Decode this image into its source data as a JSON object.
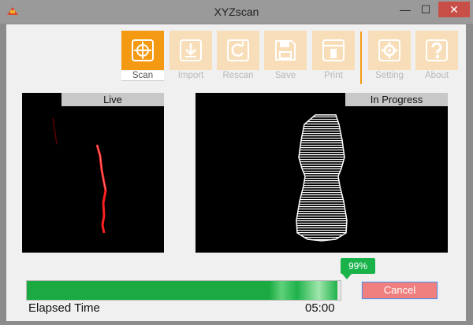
{
  "window": {
    "title": "XYZscan",
    "minimize_glyph": "—",
    "maximize_glyph": "☐",
    "close_glyph": "✕"
  },
  "toolbar": {
    "items": [
      {
        "label": "Scan",
        "icon": "scan-icon",
        "active": true
      },
      {
        "label": "Import",
        "icon": "import-icon",
        "active": false
      },
      {
        "label": "Rescan",
        "icon": "rescan-icon",
        "active": false
      },
      {
        "label": "Save",
        "icon": "save-icon",
        "active": false
      },
      {
        "label": "Print",
        "icon": "print-icon",
        "active": false
      },
      {
        "label": "Setting",
        "icon": "gear-icon",
        "active": false
      },
      {
        "label": "About",
        "icon": "question-icon",
        "active": false
      }
    ]
  },
  "panes": {
    "live": {
      "label": "Live"
    },
    "progress": {
      "label": "In Progress"
    }
  },
  "progress": {
    "percent": 99,
    "percent_label": "99%"
  },
  "actions": {
    "cancel_label": "Cancel"
  },
  "elapsed": {
    "label": "Elapsed Time",
    "value": "05:00"
  },
  "colors": {
    "accent": "#f49a12",
    "accent_light": "#f8deb8",
    "progress_green": "#19b34a",
    "cancel_red": "#f08080",
    "laser": "#ff2020"
  }
}
